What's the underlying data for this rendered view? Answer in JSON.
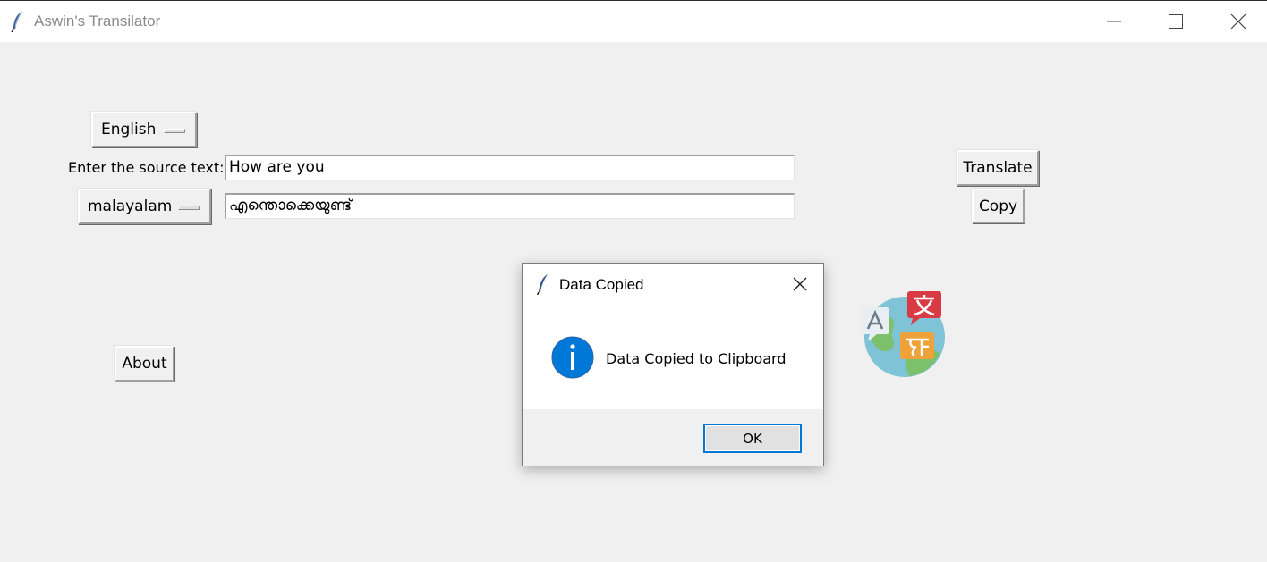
{
  "window": {
    "title": "Aswin's Transilator"
  },
  "main": {
    "source_language": "English",
    "source_label": "Enter the source text:",
    "source_text": "How are you",
    "target_language": "malayalam",
    "target_text": "എന്തൊക്കെയുണ്ട്",
    "translate_label": "Translate",
    "copy_label": "Copy",
    "about_label": "About"
  },
  "dialog": {
    "title": "Data Copied",
    "message": "Data Copied to Clipboard",
    "ok_label": "OK"
  },
  "icons": {
    "app": "feather-icon",
    "dialog_info": "info-icon",
    "translate_logo": "globe-translate-icon"
  },
  "colors": {
    "window_bg": "#f0f0f0",
    "info_blue": "#0078d7",
    "dialog_focus": "#0078d7"
  }
}
